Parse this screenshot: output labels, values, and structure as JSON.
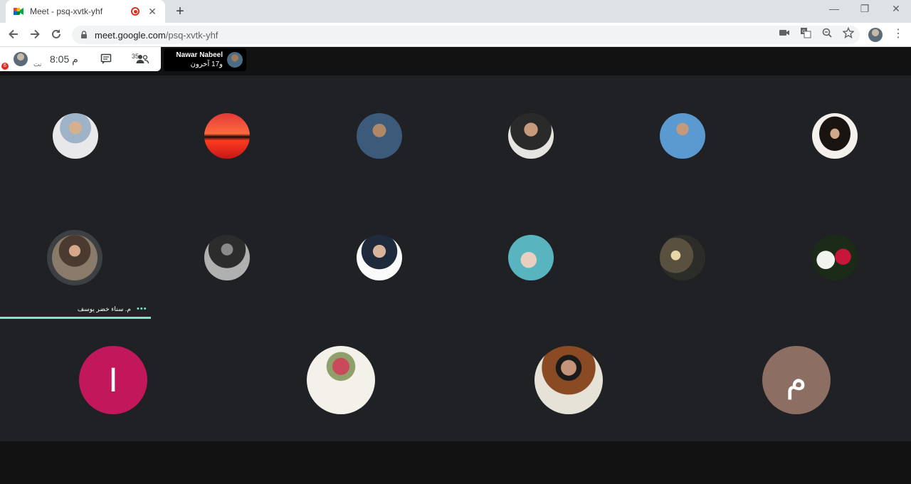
{
  "browser": {
    "tab_title": "Meet - psq-xvtk-yhf",
    "tab_close": "✕",
    "new_tab": "+",
    "url_host": "meet.google.com",
    "url_path": "/psq-xvtk-yhf",
    "window_minimize": "—",
    "window_restore": "❐",
    "window_close": "✕"
  },
  "meet": {
    "time": "8:05 م",
    "you_label": "نت",
    "notification_count": "6",
    "participant_count": "35",
    "presenter_name": "Nawar Nabeel",
    "presenter_sub": "و17 آخرون"
  },
  "speaker": {
    "name": "م. سناء خضر يوسف",
    "dots": "•••"
  },
  "tiles_bottom": [
    {
      "initial": "I",
      "color": "#c2185b"
    },
    {
      "initial": "",
      "color": "#f3f1ea"
    },
    {
      "initial": "",
      "color": "#6b4a3a"
    },
    {
      "initial": "م",
      "color": "#8d6e63"
    }
  ],
  "colors": {
    "accent": "#7fe5c8",
    "grid_bg": "#202124",
    "recording": "#d93025"
  }
}
